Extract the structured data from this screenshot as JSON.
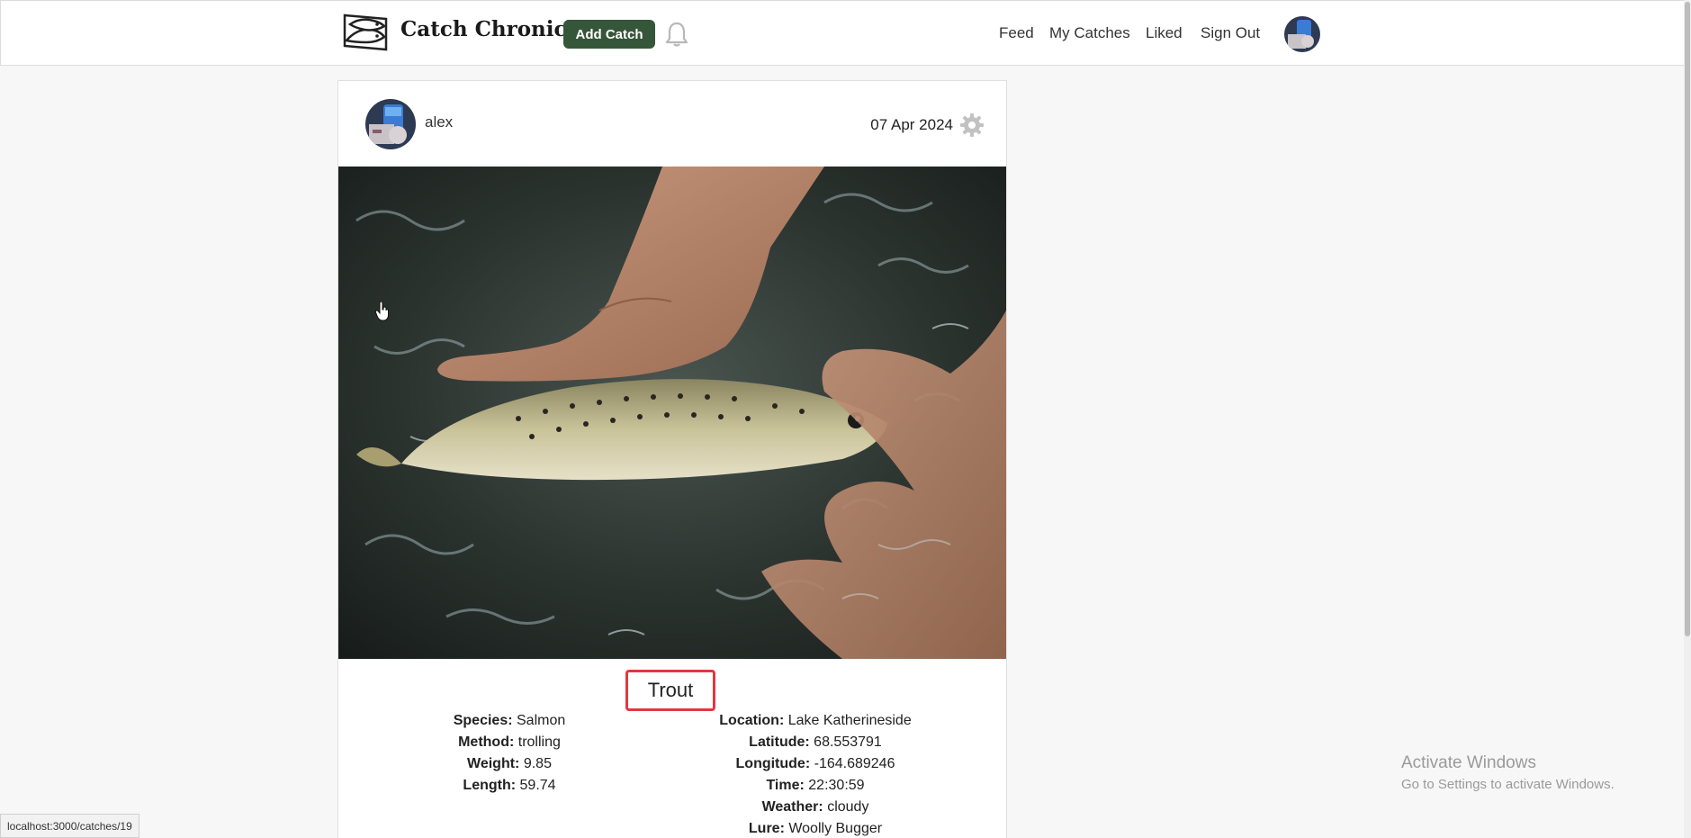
{
  "navbar": {
    "brand": "Catch Chronicle",
    "add_catch_label": "Add Catch",
    "links": [
      "Feed",
      "My Catches",
      "Liked",
      "Sign Out"
    ],
    "logo_icon": "fish-logo-icon",
    "notification_icon": "bell-icon",
    "accent_color": "#36563a"
  },
  "post": {
    "username": "alex",
    "date": "07 Apr 2024",
    "settings_icon": "gear-icon",
    "title": "Trout",
    "details_left": [
      {
        "label": "Species:",
        "value": "Salmon"
      },
      {
        "label": "Method:",
        "value": "trolling"
      },
      {
        "label": "Weight:",
        "value": "9.85"
      },
      {
        "label": "Length:",
        "value": "59.74"
      }
    ],
    "details_right": [
      {
        "label": "Location:",
        "value": "Lake Katherineside"
      },
      {
        "label": "Latitude:",
        "value": "68.553791"
      },
      {
        "label": "Longitude:",
        "value": "-164.689246"
      },
      {
        "label": "Time:",
        "value": "22:30:59"
      },
      {
        "label": "Weather:",
        "value": "cloudy"
      },
      {
        "label": "Lure:",
        "value": "Woolly Bugger"
      }
    ]
  },
  "system": {
    "activate_title": "Activate Windows",
    "activate_sub": "Go to Settings to activate Windows.",
    "status_url": "localhost:3000/catches/19"
  }
}
